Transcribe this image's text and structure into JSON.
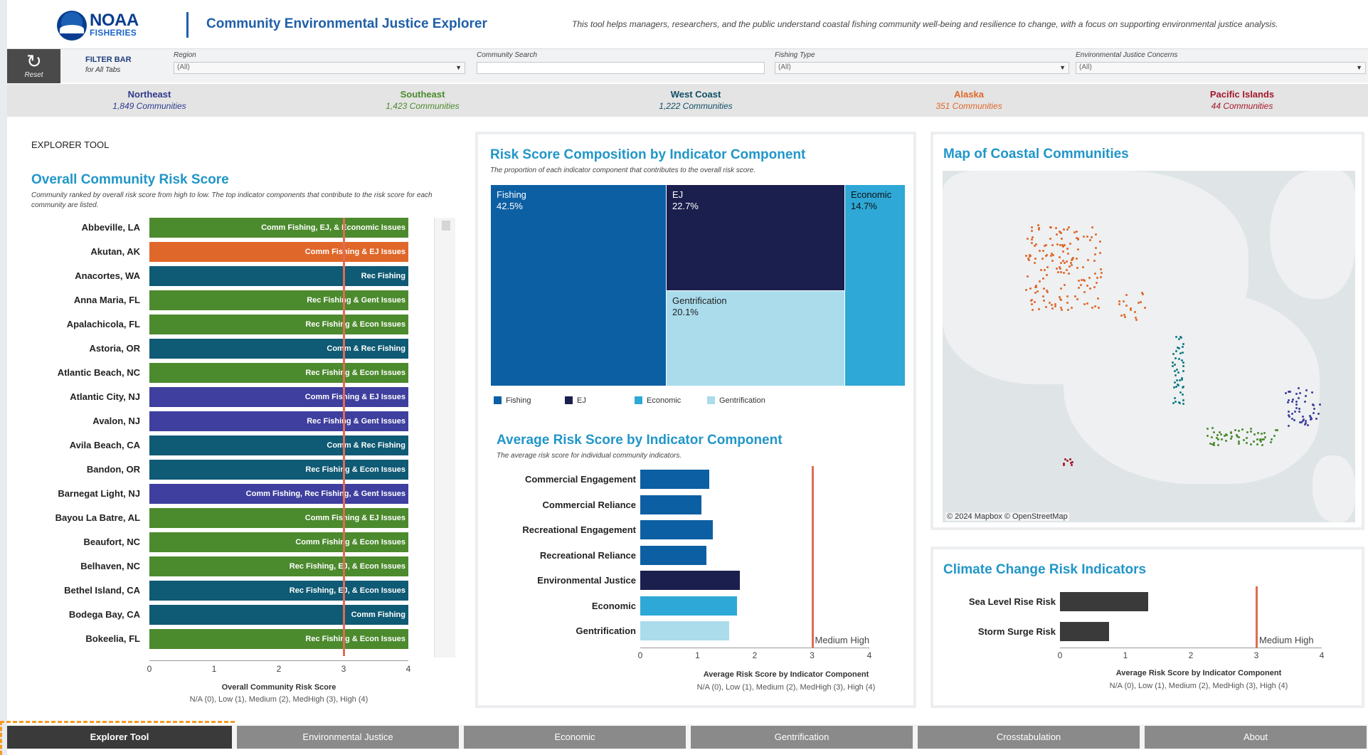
{
  "header": {
    "logo_noaa": "NOAA",
    "logo_fisheries": "FISHERIES",
    "title": "Community Environmental Justice Explorer",
    "tagline": "This tool helps managers, researchers, and the public understand coastal fishing community well-being and resilience to change, with a focus on supporting environmental justice analysis."
  },
  "filterbar": {
    "reset_label": "Reset",
    "title": "FILTER BAR",
    "subtitle": "for All Tabs",
    "filters": [
      {
        "label": "Region",
        "value": "(All)"
      },
      {
        "label": "Community Search",
        "value": ""
      },
      {
        "label": "Fishing Type",
        "value": "(All)"
      },
      {
        "label": "Environmental Justice Concerns",
        "value": "(All)"
      }
    ]
  },
  "regions": [
    {
      "name": "Northeast",
      "count": "1,849 Communities",
      "color": "#2e3a8c"
    },
    {
      "name": "Southeast",
      "count": "1,423 Communities",
      "color": "#4c8a2e"
    },
    {
      "name": "West Coast",
      "count": "1,222 Communities",
      "color": "#0f4f66"
    },
    {
      "name": "Alaska",
      "count": "351 Communities",
      "color": "#e0672a"
    },
    {
      "name": "Pacific Islands",
      "count": "44 Communities",
      "color": "#a3182a"
    }
  ],
  "explorer": {
    "section_label": "EXPLORER TOOL",
    "title": "Overall Community Risk Score",
    "subtitle": "Community ranked by overall risk score from high to low. The top indicator components that contribute to the risk score for each community are listed.",
    "axis_title": "Overall Community  Risk Score",
    "axis_note": "N/A (0), Low (1), Medium (2), MedHigh (3), High (4)",
    "ticks": [
      "0",
      "1",
      "2",
      "3",
      "4"
    ],
    "rows": [
      {
        "name": "Abbeville, LA",
        "label": "Comm Fishing, EJ, & Economic Issues",
        "color": "#4c8a2e"
      },
      {
        "name": "Akutan, AK",
        "label": "Comm Fishing & EJ Issues",
        "color": "#e0672a"
      },
      {
        "name": "Anacortes, WA",
        "label": "Rec Fishing",
        "color": "#0f5a74"
      },
      {
        "name": "Anna Maria, FL",
        "label": "Rec Fishing & Gent Issues",
        "color": "#4c8a2e"
      },
      {
        "name": "Apalachicola, FL",
        "label": "Rec Fishing & Econ Issues",
        "color": "#4c8a2e"
      },
      {
        "name": "Astoria, OR",
        "label": "Comm & Rec Fishing",
        "color": "#0f5a74"
      },
      {
        "name": "Atlantic Beach, NC",
        "label": "Rec Fishing & Econ Issues",
        "color": "#4c8a2e"
      },
      {
        "name": "Atlantic City, NJ",
        "label": "Comm Fishing & EJ Issues",
        "color": "#3e3f9e"
      },
      {
        "name": "Avalon, NJ",
        "label": "Rec Fishing & Gent Issues",
        "color": "#3e3f9e"
      },
      {
        "name": "Avila Beach, CA",
        "label": "Comm & Rec Fishing",
        "color": "#0f5a74"
      },
      {
        "name": "Bandon, OR",
        "label": "Rec Fishing & Econ Issues",
        "color": "#0f5a74"
      },
      {
        "name": "Barnegat Light, NJ",
        "label": "Comm Fishing, Rec Fishing, & Gent Issues",
        "color": "#3e3f9e"
      },
      {
        "name": "Bayou La Batre, AL",
        "label": "Comm Fishing & EJ Issues",
        "color": "#4c8a2e"
      },
      {
        "name": "Beaufort, NC",
        "label": "Comm Fishing & Econ Issues",
        "color": "#4c8a2e"
      },
      {
        "name": "Belhaven, NC",
        "label": "Rec Fishing, EJ, & Econ Issues",
        "color": "#4c8a2e"
      },
      {
        "name": "Bethel Island, CA",
        "label": "Rec Fishing, EJ, & Econ Issues",
        "color": "#0f5a74"
      },
      {
        "name": "Bodega Bay, CA",
        "label": "Comm Fishing",
        "color": "#0f5a74"
      },
      {
        "name": "Bokeelia, FL",
        "label": "Rec Fishing & Econ Issues",
        "color": "#4c8a2e"
      }
    ]
  },
  "composition": {
    "title": "Risk Score Composition by Indicator Component",
    "subtitle": "The proportion of each indicator component that contributes to the overall risk score.",
    "tiles": [
      {
        "name": "Fishing",
        "pct": "42.5%",
        "color": "#0d5fa3"
      },
      {
        "name": "EJ",
        "pct": "22.7%",
        "color": "#1b1f4d"
      },
      {
        "name": "Gentrification",
        "pct": "20.1%",
        "color": "#aadcec"
      },
      {
        "name": "Economic",
        "pct": "14.7%",
        "color": "#2ea8d6"
      }
    ],
    "legend": [
      "Fishing",
      "EJ",
      "Economic",
      "Gentrification"
    ]
  },
  "average": {
    "title": "Average Risk Score by Indicator Component",
    "subtitle": "The average risk score for individual community indicators.",
    "threshold_label": "Medium High",
    "axis_title": "Average Risk Score by Indicator Component",
    "axis_note": "N/A (0), Low (1), Medium (2), MedHigh (3), High (4)",
    "ticks": [
      "0",
      "1",
      "2",
      "3",
      "4"
    ]
  },
  "chart_data": [
    {
      "type": "bar",
      "title": "Average Risk Score by Indicator Component",
      "categories": [
        "Commercial Engagement",
        "Commercial Reliance",
        "Recreational Engagement",
        "Recreational Reliance",
        "Environmental Justice",
        "Economic",
        "Gentrification"
      ],
      "values": [
        1.2,
        1.07,
        1.27,
        1.16,
        1.74,
        1.69,
        1.55
      ],
      "colors": [
        "#0d5fa3",
        "#0d5fa3",
        "#0d5fa3",
        "#0d5fa3",
        "#1b1f4d",
        "#2ea8d6",
        "#aadcec"
      ],
      "xlabel": "Average Risk Score by Indicator Component",
      "xlim": [
        0,
        4
      ],
      "threshold": 3
    },
    {
      "type": "bar",
      "title": "Climate Change Risk Indicators",
      "categories": [
        "Sea Level Rise Risk",
        "Storm Surge Risk"
      ],
      "values": [
        1.35,
        0.75
      ],
      "colors": [
        "#3a3a3a",
        "#3a3a3a"
      ],
      "xlabel": "Average Risk Score by Indicator Component",
      "xlim": [
        0,
        4
      ],
      "threshold": 3
    },
    {
      "type": "treemap",
      "title": "Risk Score Composition by Indicator Component",
      "categories": [
        "Fishing",
        "EJ",
        "Gentrification",
        "Economic"
      ],
      "values": [
        42.5,
        22.7,
        20.1,
        14.7
      ]
    }
  ],
  "map": {
    "title": "Map of Coastal Communities",
    "credit": "© 2024 Mapbox  © OpenStreetMap"
  },
  "climate": {
    "title": "Climate Change Risk Indicators",
    "threshold_label": "Medium High",
    "axis_title": "Average Risk Score by Indicator Component",
    "axis_note": "N/A (0), Low (1), Medium (2), MedHigh (3), High (4)",
    "ticks": [
      "0",
      "1",
      "2",
      "3",
      "4"
    ]
  },
  "tabs": [
    {
      "label": "Explorer Tool",
      "active": true
    },
    {
      "label": "Environmental Justice",
      "active": false
    },
    {
      "label": "Economic",
      "active": false
    },
    {
      "label": "Gentrification",
      "active": false
    },
    {
      "label": "Crosstabulation",
      "active": false
    },
    {
      "label": "About",
      "active": false
    }
  ]
}
